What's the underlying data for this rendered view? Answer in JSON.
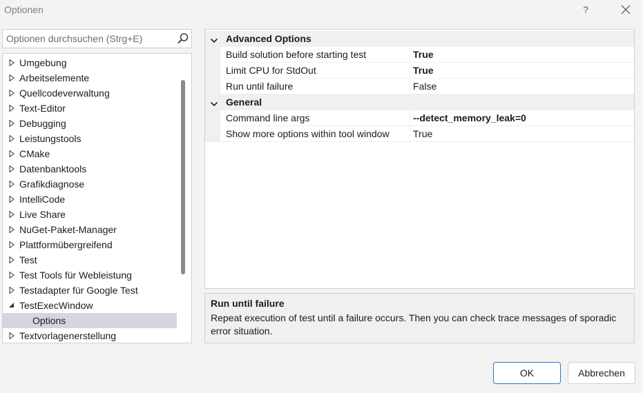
{
  "window": {
    "title": "Optionen",
    "help_label": "?"
  },
  "search": {
    "placeholder": "Optionen durchsuchen (Strg+E)"
  },
  "tree": {
    "items": [
      {
        "label": "Umgebung",
        "expanded": false
      },
      {
        "label": "Arbeitselemente",
        "expanded": false
      },
      {
        "label": "Quellcodeverwaltung",
        "expanded": false
      },
      {
        "label": "Text-Editor",
        "expanded": false
      },
      {
        "label": "Debugging",
        "expanded": false
      },
      {
        "label": "Leistungstools",
        "expanded": false
      },
      {
        "label": "CMake",
        "expanded": false
      },
      {
        "label": "Datenbanktools",
        "expanded": false
      },
      {
        "label": "Grafikdiagnose",
        "expanded": false
      },
      {
        "label": "IntelliCode",
        "expanded": false
      },
      {
        "label": "Live Share",
        "expanded": false
      },
      {
        "label": "NuGet-Paket-Manager",
        "expanded": false
      },
      {
        "label": "Plattformübergreifend",
        "expanded": false
      },
      {
        "label": "Test",
        "expanded": false
      },
      {
        "label": "Test Tools für Webleistung",
        "expanded": false
      },
      {
        "label": "Testadapter für Google Test",
        "expanded": false
      },
      {
        "label": "TestExecWindow",
        "expanded": true
      },
      {
        "label": "Options",
        "child": true,
        "selected": true
      },
      {
        "label": "Textvorlagenerstellung",
        "expanded": false
      }
    ]
  },
  "properties": {
    "categories": [
      {
        "label": "Advanced Options",
        "rows": [
          {
            "name": "Build solution before starting test",
            "value": "True",
            "bold": true
          },
          {
            "name": "Limit CPU for StdOut",
            "value": "True",
            "bold": true
          },
          {
            "name": "Run until failure",
            "value": "False",
            "bold": false
          }
        ]
      },
      {
        "label": "General",
        "rows": [
          {
            "name": "Command line args",
            "value": "--detect_memory_leak=0",
            "bold": true
          },
          {
            "name": "Show more options within tool window",
            "value": "True",
            "bold": false
          }
        ]
      }
    ]
  },
  "description": {
    "title": "Run until failure",
    "text": "Repeat execution of test until a failure occurs. Then you can check trace messages of sporadic error situation."
  },
  "buttons": {
    "ok_label": "OK",
    "cancel_label": "Abbrechen"
  },
  "colors": {
    "accent": "#2a73c8",
    "selection": "#d5d5df"
  }
}
